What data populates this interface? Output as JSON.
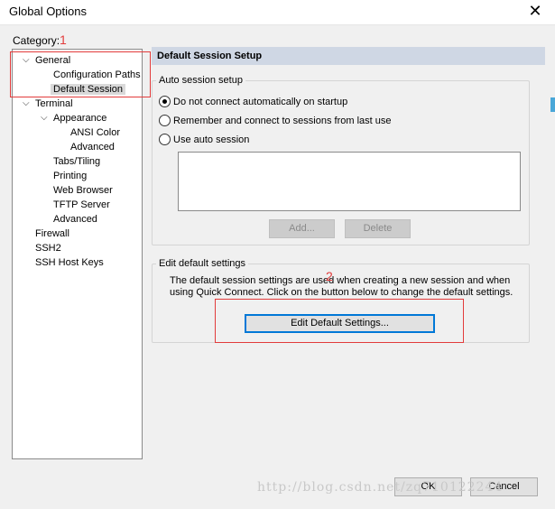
{
  "window": {
    "title": "Global Options",
    "close_glyph": "✕"
  },
  "category_label": "Category:",
  "annotations": {
    "marker_1": "1",
    "marker_2": "2",
    "box_color": "#e23b3b"
  },
  "tree": {
    "items": [
      {
        "label": "General",
        "expanded": true
      },
      {
        "label": "Configuration Paths"
      },
      {
        "label": "Default Session",
        "selected": true
      },
      {
        "label": "Terminal",
        "expanded": true
      },
      {
        "label": "Appearance",
        "expanded": true
      },
      {
        "label": "ANSI Color"
      },
      {
        "label": "Advanced"
      },
      {
        "label": "Tabs/Tiling"
      },
      {
        "label": "Printing"
      },
      {
        "label": "Web Browser"
      },
      {
        "label": "TFTP Server"
      },
      {
        "label": "Advanced"
      },
      {
        "label": "Firewall"
      },
      {
        "label": "SSH2"
      },
      {
        "label": "SSH Host Keys"
      }
    ]
  },
  "panel": {
    "header": "Default Session Setup",
    "header_color": "#cfd7e4",
    "auto_session": {
      "title": "Auto session setup",
      "options": [
        {
          "label": "Do not connect automatically on startup",
          "checked": true
        },
        {
          "label": "Remember and connect to sessions from last use",
          "checked": false
        },
        {
          "label": "Use auto session",
          "checked": false
        }
      ],
      "add_button": "Add...",
      "delete_button": "Delete"
    },
    "edit_defaults": {
      "title": "Edit default settings",
      "description_line1": "The default session settings are used when creating a new session and when",
      "description_line2": "using Quick Connect.  Click on the button below to change the default settings.",
      "button": "Edit Default Settings..."
    }
  },
  "footer": {
    "ok": "OK",
    "cancel": "Cancel"
  },
  "watermark": "http://blog.csdn.net/zq710122244"
}
